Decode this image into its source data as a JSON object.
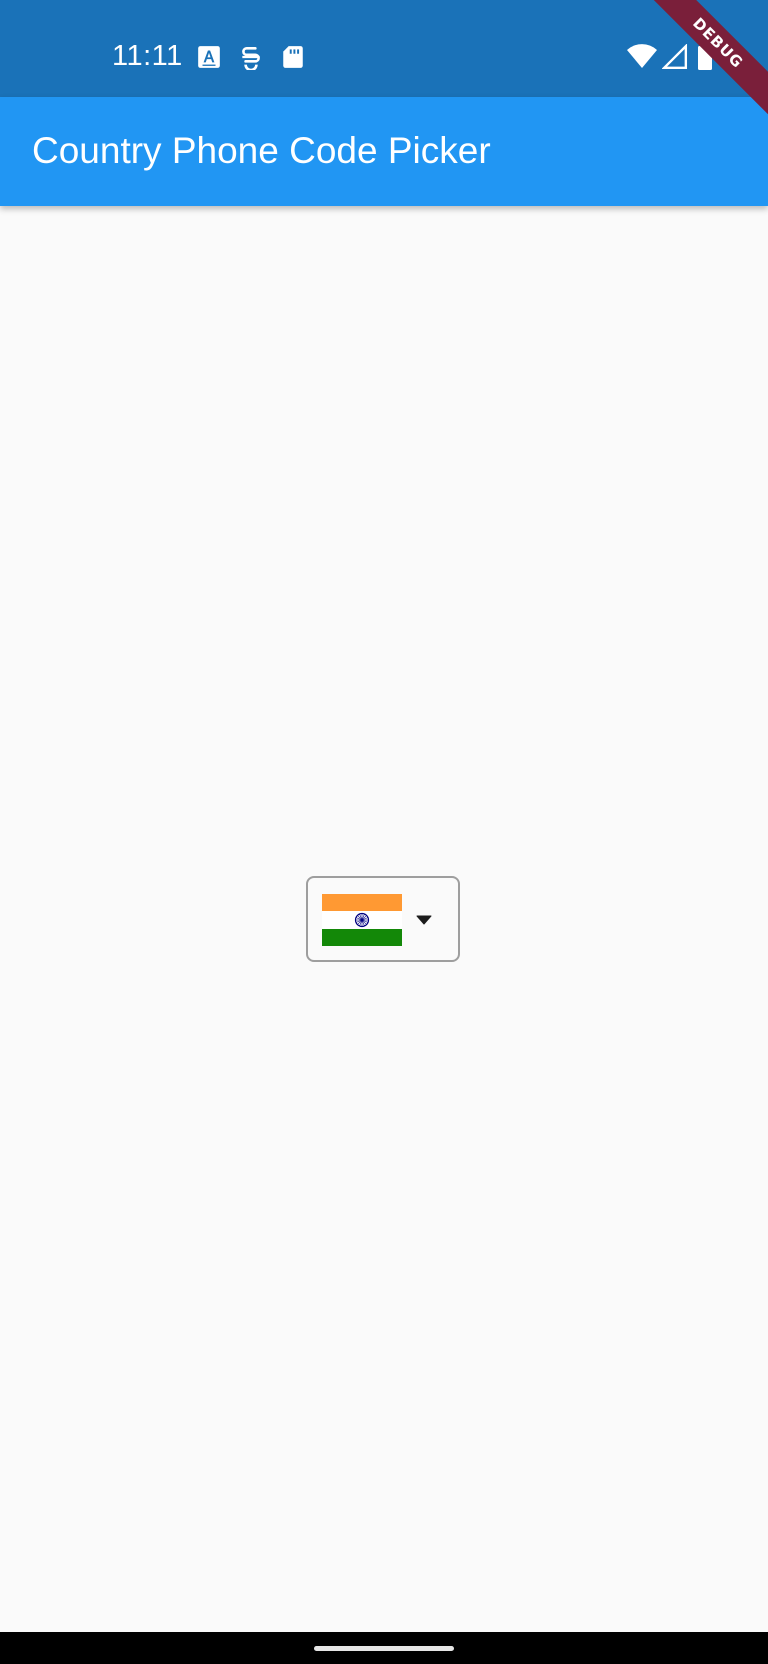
{
  "status_bar": {
    "time": "11:11",
    "background": "#1a72b8",
    "left_icons": [
      "a-keyboard-icon",
      "s-sync-icon",
      "sd-card-icon"
    ],
    "right_icons": [
      "wifi-icon",
      "cell-signal-icon",
      "battery-icon"
    ]
  },
  "debug_banner": {
    "label": "DEBUG",
    "color": "#7a1f3a"
  },
  "app_bar": {
    "title": "Country Phone Code Picker",
    "background": "#2196f3"
  },
  "country_picker": {
    "selected_country_flag": "india-flag",
    "flag_colors": {
      "saffron": "#ff9933",
      "white": "#ffffff",
      "green": "#138808",
      "chakra": "#000080"
    },
    "dropdown_icon": "arrow-drop-down-icon",
    "border_color": "#9e9e9e"
  },
  "navigation_bar": {
    "handle": "gesture-handle"
  }
}
